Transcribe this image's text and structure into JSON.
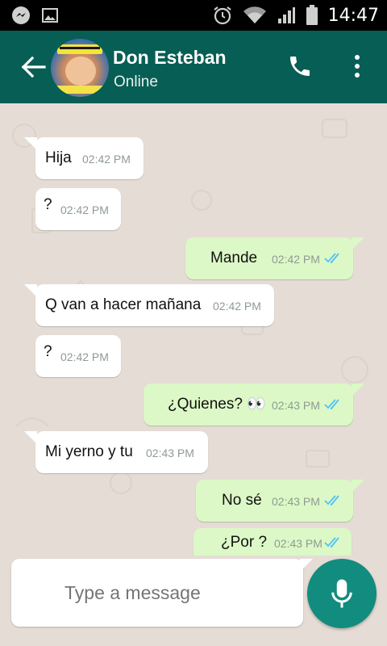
{
  "status_bar": {
    "time": "14:47",
    "icons": [
      "messenger-icon",
      "image-icon",
      "alarm-icon",
      "wifi-icon",
      "signal-icon",
      "battery-icon"
    ]
  },
  "header": {
    "contact_name": "Don Esteban",
    "contact_status": "Online",
    "icons": [
      "back-arrow-icon",
      "phone-icon",
      "more-vert-icon"
    ],
    "color": "#075e54"
  },
  "messages": [
    {
      "direction": "in",
      "text": "Hija",
      "time": "02:42 PM"
    },
    {
      "direction": "in",
      "text": "?",
      "time": "02:42 PM"
    },
    {
      "direction": "out",
      "text": "Mande",
      "time": "02:42 PM",
      "status": "read"
    },
    {
      "direction": "in",
      "text": "Q van a hacer mañana",
      "time": "02:42 PM"
    },
    {
      "direction": "in",
      "text": "?",
      "time": "02:42 PM"
    },
    {
      "direction": "out",
      "text": "¿Quienes? 👀",
      "time": "02:43 PM",
      "status": "read"
    },
    {
      "direction": "in",
      "text": "Mi yerno y tu",
      "time": "02:43 PM"
    },
    {
      "direction": "out",
      "text": "No sé",
      "time": "02:43 PM",
      "status": "read"
    },
    {
      "direction": "out",
      "text": "¿Por ?",
      "time": "02:43 PM",
      "status": "read"
    }
  ],
  "composer": {
    "placeholder": "Type a message",
    "icon": "mic-icon"
  },
  "colors": {
    "incoming_bubble": "#ffffff",
    "outgoing_bubble": "#dcf8c6",
    "chat_background": "#e5ddd5",
    "read_ticks": "#4fc3f7",
    "mic_button": "#128c7e"
  }
}
